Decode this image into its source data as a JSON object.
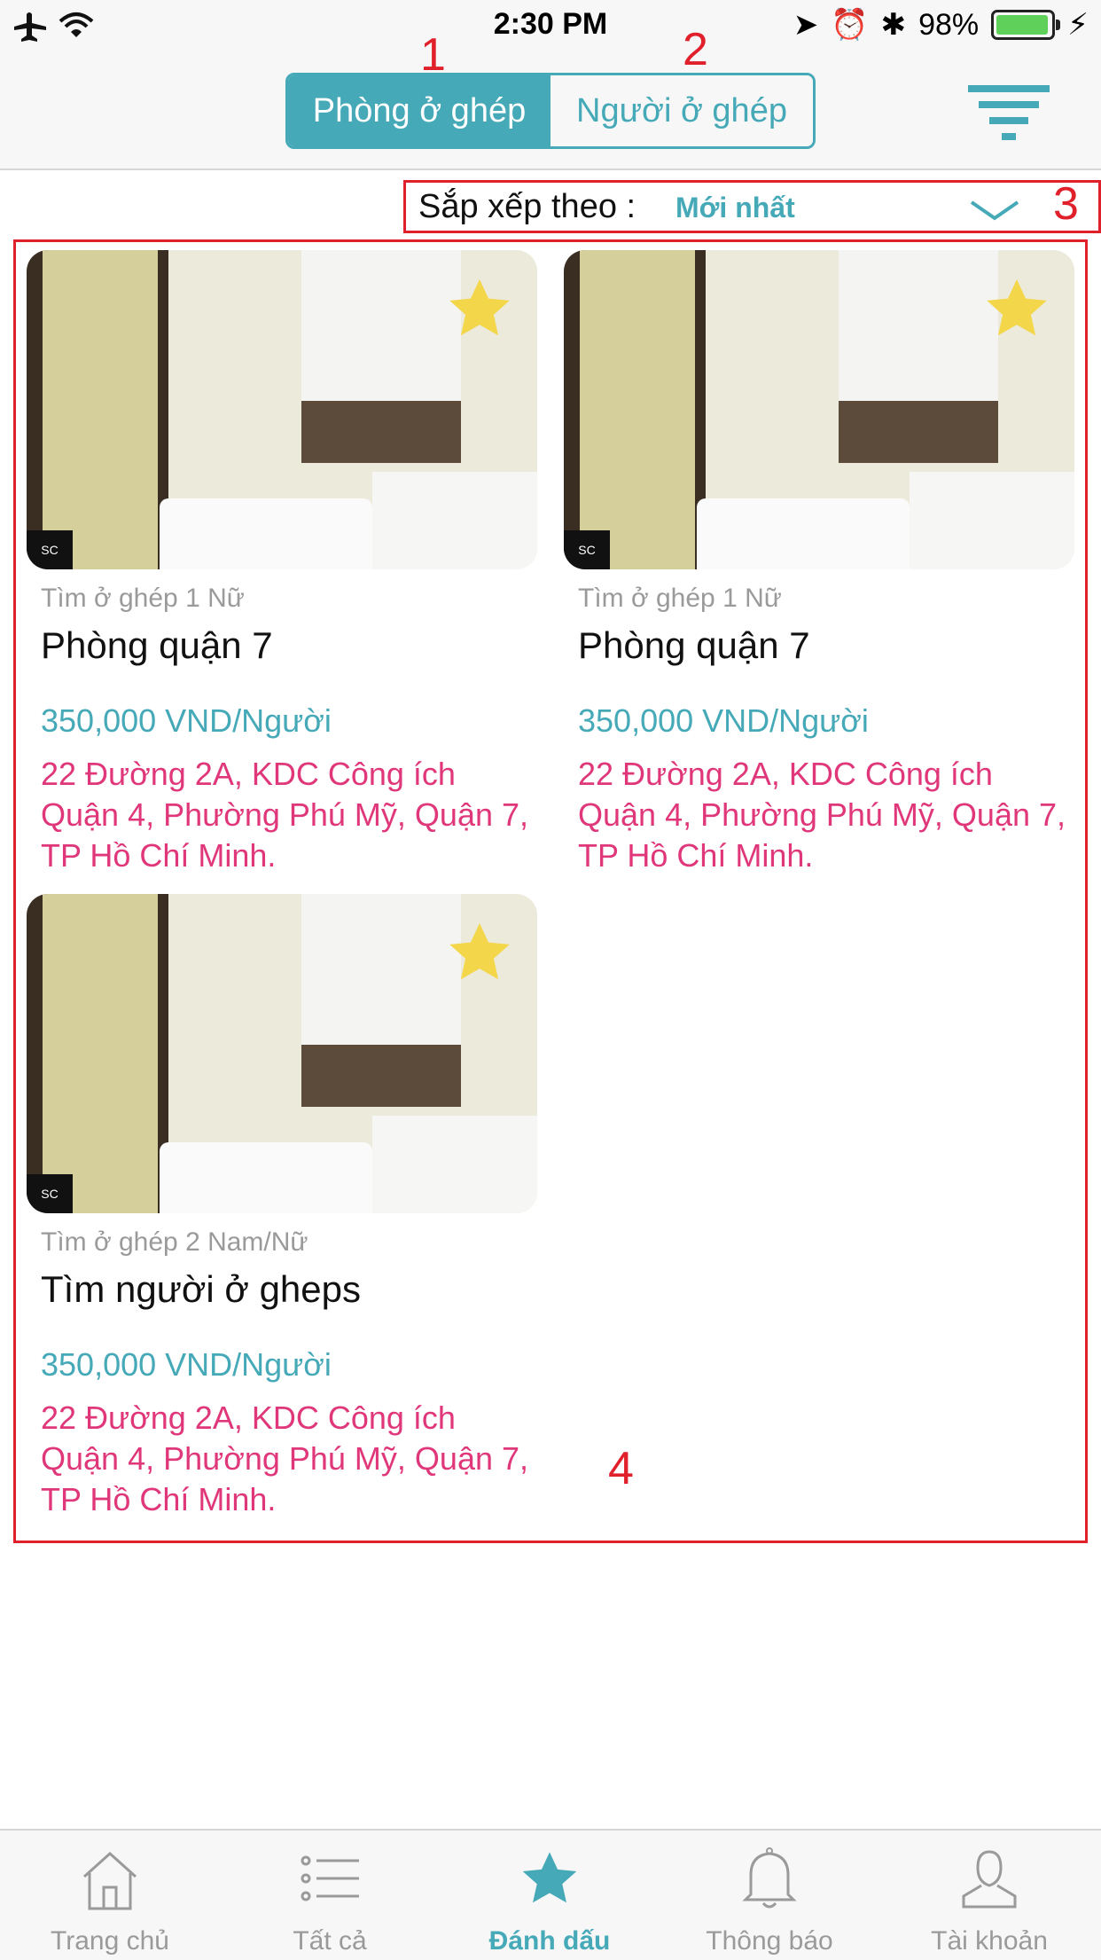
{
  "status_bar": {
    "time": "2:30 PM",
    "battery": "98%"
  },
  "segmented": {
    "tab1": "Phòng ở ghép",
    "tab2": "Người ở ghép"
  },
  "sort": {
    "label": "Sắp xếp theo :",
    "value": "Mới nhất"
  },
  "annotations": [
    "1",
    "2",
    "3",
    "4"
  ],
  "cards": [
    {
      "type": "Tìm ở ghép 1 Nữ",
      "title": "Phòng quận 7",
      "price": "350,000 VND/Người",
      "address": "22 Đường 2A, KDC Công ích Quận 4, Phường Phú Mỹ, Quận 7, TP Hồ Chí Minh."
    },
    {
      "type": "Tìm ở ghép 1 Nữ",
      "title": "Phòng quận 7",
      "price": "350,000 VND/Người",
      "address": "22 Đường 2A, KDC Công ích Quận 4, Phường Phú Mỹ, Quận 7, TP Hồ Chí Minh."
    },
    {
      "type": "Tìm ở ghép 2 Nam/Nữ",
      "title": "Tìm người ở gheps",
      "price": "350,000 VND/Người",
      "address": "22 Đường 2A, KDC Công ích Quận 4, Phường Phú Mỹ, Quận 7, TP Hồ Chí Minh."
    }
  ],
  "tabbar": [
    {
      "label": "Trang chủ",
      "icon": "home-icon"
    },
    {
      "label": "Tất cả",
      "icon": "list-icon"
    },
    {
      "label": "Đánh dấu",
      "icon": "star-icon",
      "active": true
    },
    {
      "label": "Thông báo",
      "icon": "bell-icon"
    },
    {
      "label": "Tài khoản",
      "icon": "user-icon"
    }
  ],
  "colors": {
    "accent": "#45a9b8",
    "address": "#e0377a",
    "annotation": "#e0202a"
  }
}
